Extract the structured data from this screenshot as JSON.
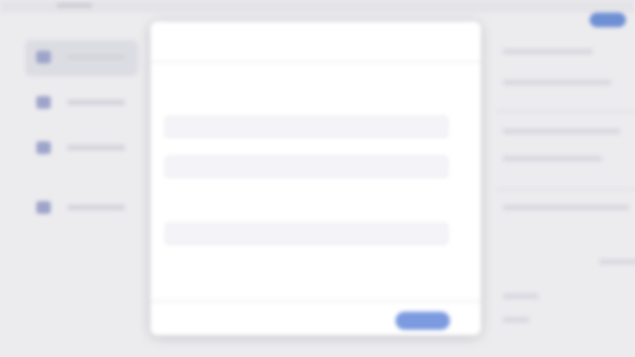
{
  "app": {
    "header": {
      "breadcrumb": ""
    },
    "top_action": {
      "label": ""
    },
    "sidebar": {
      "items": [
        {
          "label": "",
          "icon": "nav-icon",
          "active": true
        },
        {
          "label": "",
          "icon": "nav-icon",
          "active": false
        },
        {
          "label": "",
          "icon": "nav-icon",
          "active": false
        },
        {
          "label": "",
          "icon": "nav-icon",
          "active": false
        }
      ]
    },
    "right_panel": {
      "lines": [
        "",
        "",
        "",
        "",
        "",
        "",
        "",
        ""
      ]
    }
  },
  "modal": {
    "title": "",
    "section_heading": "",
    "fields": [
      {
        "label": "",
        "value": ""
      },
      {
        "label": "",
        "value": ""
      },
      {
        "label": "",
        "value": ""
      }
    ],
    "helper_text": "",
    "cancel_label": "",
    "primary_label": ""
  },
  "colors": {
    "accent": "#7c9ae0",
    "background": "#ececef",
    "modal_bg": "#ffffff"
  }
}
